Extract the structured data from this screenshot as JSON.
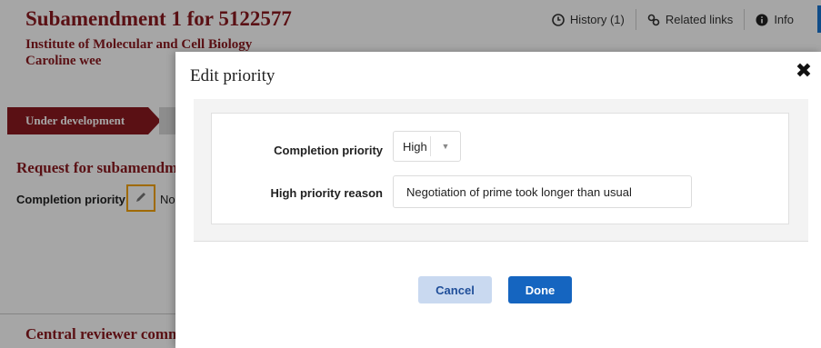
{
  "background": {
    "title": "Subamendment 1 for 5122577",
    "institute": "Institute of Molecular and Cell Biology",
    "owner": "Caroline wee",
    "header_links": [
      {
        "label": "History (1)",
        "icon": "clock-icon"
      },
      {
        "label": "Related links",
        "icon": "link-icon"
      },
      {
        "label": "Info",
        "icon": "info-icon"
      }
    ],
    "stage": "Under development",
    "section_title": "Request for subamendment",
    "field_label": "Completion priority",
    "field_value": "Normal",
    "footer_section": "Central reviewer comments"
  },
  "modal": {
    "title": "Edit priority",
    "close_symbol": "✖",
    "completion_priority_label": "Completion priority",
    "completion_priority_value": "High",
    "high_priority_reason_label": "High priority reason",
    "high_priority_reason_value": "Negotiation of prime took longer than usual",
    "cancel_label": "Cancel",
    "done_label": "Done"
  },
  "colors": {
    "brand": "#8b1a1f",
    "primary": "#1565c0",
    "secondary_button": "#c9d9f0",
    "highlight": "#f5a300"
  }
}
